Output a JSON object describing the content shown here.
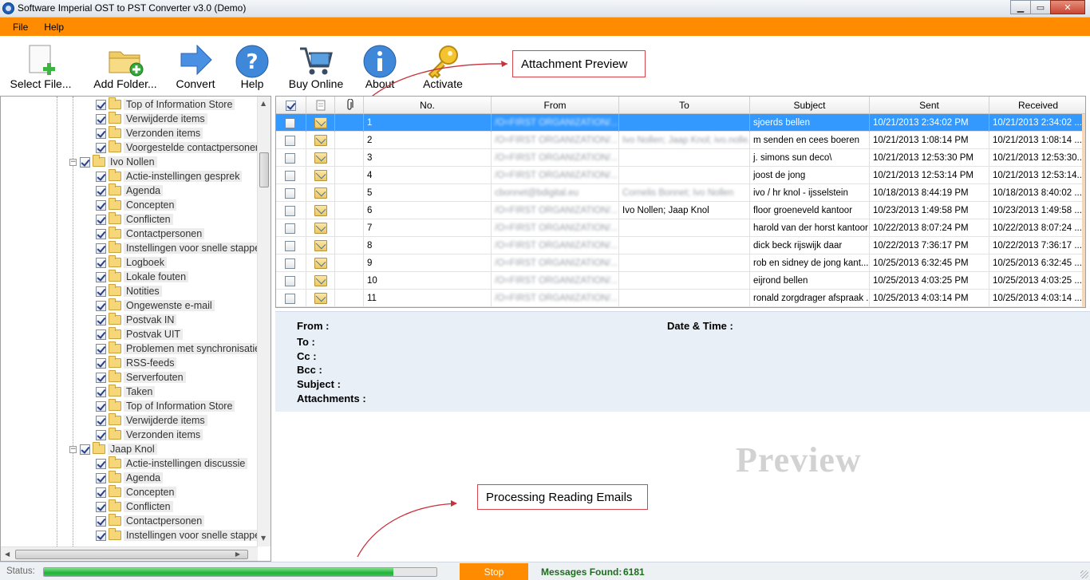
{
  "window": {
    "title": "Software Imperial OST to PST Converter v3.0 (Demo)",
    "min_glyph": "▁",
    "max_glyph": "▭",
    "close_glyph": "✕"
  },
  "menu": [
    "File",
    "Help"
  ],
  "toolbar": {
    "select_file": "Select File...",
    "add_folder": "Add Folder...",
    "convert": "Convert",
    "help": "Help",
    "buy_online": "Buy Online",
    "about": "About",
    "activate": "Activate"
  },
  "callouts": {
    "attachment_preview": "Attachment Preview",
    "processing": "Processing Reading Emails"
  },
  "tree": {
    "group1_items": [
      "Top of Information Store",
      "Verwijderde items",
      "Verzonden items",
      "Voorgestelde contactpersonen"
    ],
    "user2": "Ivo Nollen",
    "user2_items": [
      "Actie-instellingen gesprek",
      "Agenda",
      "Concepten",
      "Conflicten",
      "Contactpersonen",
      "Instellingen voor snelle stappen",
      "Logboek",
      "Lokale fouten",
      "Notities",
      "Ongewenste e-mail",
      "Postvak IN",
      "Postvak UIT",
      "Problemen met synchronisatie",
      "RSS-feeds",
      "Serverfouten",
      "Taken",
      "Top of Information Store",
      "Verwijderde items",
      "Verzonden items"
    ],
    "user3": "Jaap Knol",
    "user3_items": [
      "Actie-instellingen discussie",
      "Agenda",
      "Concepten",
      "Conflicten",
      "Contactpersonen",
      "Instellingen voor snelle stappen"
    ]
  },
  "grid": {
    "headers": {
      "no": "No.",
      "from": "From",
      "to": "To",
      "subject": "Subject",
      "sent": "Sent",
      "received": "Received"
    },
    "rows": [
      {
        "no": "1",
        "from": "/O=FIRST ORGANIZATION/...",
        "to": "",
        "subject": "sjoerds bellen",
        "sent": "10/21/2013 2:34:02 PM",
        "received": "10/21/2013 2:34:02 ..."
      },
      {
        "no": "2",
        "from": "/O=FIRST ORGANIZATION/...",
        "to": "Ivo Nollen; Jaap Knol; ivo.nolle...",
        "subject": "m senden en cees boeren",
        "sent": "10/21/2013 1:08:14 PM",
        "received": "10/21/2013 1:08:14 ..."
      },
      {
        "no": "3",
        "from": "/O=FIRST ORGANIZATION/...",
        "to": "",
        "subject": "j. simons sun deco\\",
        "sent": "10/21/2013 12:53:30 PM",
        "received": "10/21/2013 12:53:30..."
      },
      {
        "no": "4",
        "from": "/O=FIRST ORGANIZATION/...",
        "to": "",
        "subject": "joost de jong",
        "sent": "10/21/2013 12:53:14 PM",
        "received": "10/21/2013 12:53:14..."
      },
      {
        "no": "5",
        "from": "cbonnet@bdigital.eu",
        "to": "Cornelis Bonnet; Ivo Nollen",
        "subject": "ivo / hr knol - ijsselstein",
        "sent": "10/18/2013 8:44:19 PM",
        "received": "10/18/2013 8:40:02 ..."
      },
      {
        "no": "6",
        "from": "/O=FIRST ORGANIZATION/...",
        "to": "Ivo Nollen; Jaap Knol",
        "subject": "floor groeneveld kantoor",
        "sent": "10/23/2013 1:49:58 PM",
        "received": "10/23/2013 1:49:58 ..."
      },
      {
        "no": "7",
        "from": "/O=FIRST ORGANIZATION/...",
        "to": "",
        "subject": "harold van der horst kantoor",
        "sent": "10/22/2013 8:07:24 PM",
        "received": "10/22/2013 8:07:24 ..."
      },
      {
        "no": "8",
        "from": "/O=FIRST ORGANIZATION/...",
        "to": "",
        "subject": "dick beck rijswijk daar",
        "sent": "10/22/2013 7:36:17 PM",
        "received": "10/22/2013 7:36:17 ..."
      },
      {
        "no": "9",
        "from": "/O=FIRST ORGANIZATION/...",
        "to": "",
        "subject": "rob en sidney de jong  kant...",
        "sent": "10/25/2013 6:32:45 PM",
        "received": "10/25/2013 6:32:45 ..."
      },
      {
        "no": "10",
        "from": "/O=FIRST ORGANIZATION/...",
        "to": "",
        "subject": "eijrond bellen",
        "sent": "10/25/2013 4:03:25 PM",
        "received": "10/25/2013 4:03:25 ..."
      },
      {
        "no": "11",
        "from": "/O=FIRST ORGANIZATION/...",
        "to": "",
        "subject": "ronald zorgdrager afspraak ...",
        "sent": "10/25/2013 4:03:14 PM",
        "received": "10/25/2013 4:03:14 ..."
      }
    ]
  },
  "preview": {
    "from": "From :",
    "datetime": "Date & Time :",
    "to": "To :",
    "cc": "Cc :",
    "bcc": "Bcc :",
    "subject": "Subject :",
    "attachments": "Attachments :",
    "watermark": "Preview"
  },
  "status": {
    "label": "Status:",
    "progress_fraction": 0.89,
    "stop": "Stop",
    "messages_found_label": "Messages Found:",
    "messages_found": "6181"
  },
  "colors": {
    "accent": "#ff8c00",
    "selection": "#3399ff",
    "progress": "#22b33a"
  }
}
